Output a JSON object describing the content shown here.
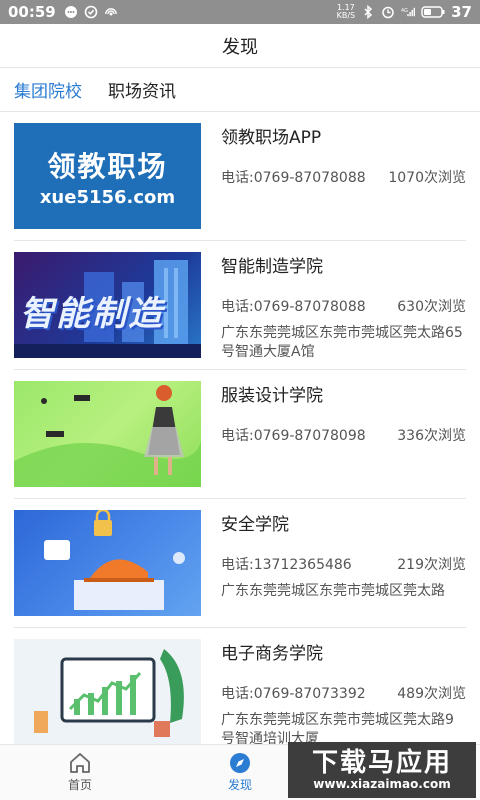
{
  "status_bar": {
    "time": "00:59",
    "net_speed_value": "1.17",
    "net_speed_unit": "KB/S",
    "network_type": "4G",
    "battery": "37"
  },
  "header": {
    "title": "发现"
  },
  "tabs": [
    {
      "label": "集团院校",
      "active": true
    },
    {
      "label": "职场资讯",
      "active": false
    }
  ],
  "items": [
    {
      "name": "领教职场APP",
      "phone": "电话:0769-87078088",
      "views": "1070次浏览",
      "address": "",
      "thumb_text_cn": "领教职场",
      "thumb_text_en": "xue5156.com"
    },
    {
      "name": "智能制造学院",
      "phone": "电话:0769-87078088",
      "views": "630次浏览",
      "address": "广东东莞莞城区东莞市莞城区莞太路65号智通大厦A馆",
      "thumb_text_cn": "智能制造"
    },
    {
      "name": "服装设计学院",
      "phone": "电话:0769-87078098",
      "views": "336次浏览",
      "address": ""
    },
    {
      "name": "安全学院",
      "phone": "电话:13712365486",
      "views": "219次浏览",
      "address": "广东东莞莞城区东莞市莞城区莞太路"
    },
    {
      "name": "电子商务学院",
      "phone": "电话:0769-87073392",
      "views": "489次浏览",
      "address": "广东东莞莞城区东莞市莞城区莞太路9号智通培训大厦"
    }
  ],
  "bottom_nav": [
    {
      "label": "首页",
      "icon": "home-icon",
      "active": false
    },
    {
      "label": "发现",
      "icon": "compass-icon",
      "active": true
    }
  ],
  "watermark": {
    "cn": "下载马应用",
    "en": "www.xiazaimao.com"
  },
  "colors": {
    "accent": "#2b7cd3",
    "status_bar": "#8f8f8f"
  }
}
